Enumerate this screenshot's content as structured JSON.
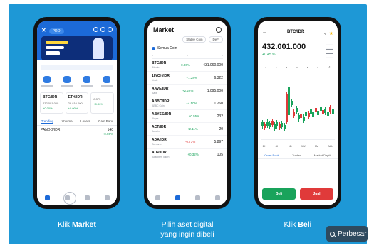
{
  "captions": {
    "step1_prefix": "Klik ",
    "step1_highlight": "Market",
    "step2_line1": "Pilih aset digital",
    "step2_line2": "yang ingin dibeli",
    "step3_prefix": "Klik ",
    "step3_highlight": "Beli"
  },
  "search_chip": {
    "label": "Perbesar",
    "icon": "search-icon"
  },
  "phone1": {
    "pill": "PRO",
    "cards": [
      {
        "pair": "BTC/IDR",
        "price": "432.001.000",
        "change": "+0.00%"
      },
      {
        "pair": "ETH/IDR",
        "price": "28.810.000",
        "change": "+0.00%"
      },
      {
        "pair": "",
        "price": "8.375",
        "change": "+0.00%"
      }
    ],
    "tabs": [
      "Trending",
      "Volume",
      "Losers",
      "Gain Baru"
    ],
    "row": {
      "pair": "PANDO/IDR",
      "price": "140",
      "change": "+0.00%"
    }
  },
  "phone2": {
    "title": "Market",
    "filters": [
      "Stable Coin",
      "DeFi"
    ],
    "coin_select": "Semua Coin",
    "rows": [
      {
        "pair": "BTC/IDR",
        "name": "Bitcoin",
        "change": "+0.00%",
        "dir": "up",
        "price": "431.060.000"
      },
      {
        "pair": "1INCH/IDR",
        "name": "1inch",
        "change": "+1.28%",
        "dir": "up",
        "price": "6.322"
      },
      {
        "pair": "AAVE/IDR",
        "name": "Aave",
        "change": "+2.22%",
        "dir": "up",
        "price": "1.095.000"
      },
      {
        "pair": "ABBC/IDR",
        "name": "ABBC Coin",
        "change": "+4.50%",
        "dir": "up",
        "price": "1.260"
      },
      {
        "pair": "ABYSS/IDR",
        "name": "Abyss",
        "change": "+0.55%",
        "dir": "up",
        "price": "232"
      },
      {
        "pair": "ACT/IDR",
        "name": "Achain",
        "change": "+2.11%",
        "dir": "up",
        "price": "20"
      },
      {
        "pair": "ADA/IDR",
        "name": "Cardano",
        "change": "-0.73%",
        "dir": "dn",
        "price": "5.897"
      },
      {
        "pair": "ADP/IDR",
        "name": "Adappter Token",
        "change": "+0.32%",
        "dir": "up",
        "price": "105"
      }
    ]
  },
  "phone3": {
    "pair": "BTC/IDR",
    "price": "432.001.000",
    "change": "+0.45 %",
    "range_tabs": [
      "1H",
      "4H",
      "1D",
      "1W",
      "1M",
      "ALL"
    ],
    "order_tabs": [
      "Order Book",
      "Trades",
      "Market Depth"
    ],
    "buy_label": "Beli",
    "sell_label": "Jual"
  },
  "colors": {
    "panel": "#1e98d6",
    "accent": "#1c6ad8",
    "buy": "#19a35b",
    "sell": "#e03a3a"
  }
}
